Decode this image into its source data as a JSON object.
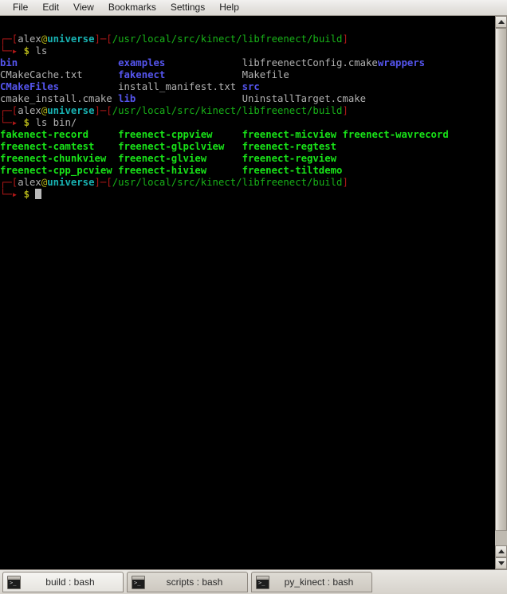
{
  "menubar": {
    "items": [
      {
        "label": "File"
      },
      {
        "label": "Edit"
      },
      {
        "label": "View"
      },
      {
        "label": "Bookmarks"
      },
      {
        "label": "Settings"
      },
      {
        "label": "Help"
      }
    ]
  },
  "terminal": {
    "colors": {
      "background": "#000000",
      "bracket_red": "#b21818",
      "user_gray": "#b2b2b2",
      "at_yellow": "#b2b218",
      "host_cyan": "#18b2b2",
      "path_green": "#18b218",
      "prompt_dollar_yellow": "#b2b218",
      "directory_blue": "#5555ee",
      "file_gray": "#b2b2b2",
      "executable_green": "#18e218",
      "cursor": "#b9b9b9"
    },
    "prompt": {
      "top_glyph": "┌─",
      "bottom_glyph": "└─▸",
      "open_bracket": "[",
      "close_bracket": "]",
      "separator": "─",
      "user": "alex",
      "at": "@",
      "host": "universe",
      "path": "/usr/local/src/kinect/libfreenect/build",
      "symbol": "$"
    },
    "blocks": [
      {
        "type": "prompt",
        "command": "ls"
      },
      {
        "type": "output",
        "rows": [
          [
            {
              "text": "bin",
              "kind": "dir"
            },
            {
              "text": "examples",
              "kind": "dir"
            },
            {
              "text": "libfreenectConfig.cmake",
              "kind": "file"
            },
            {
              "text": "wrappers",
              "kind": "dir"
            }
          ],
          [
            {
              "text": "CMakeCache.txt",
              "kind": "file"
            },
            {
              "text": "fakenect",
              "kind": "dir"
            },
            {
              "text": "Makefile",
              "kind": "file"
            },
            {
              "text": "",
              "kind": "file"
            }
          ],
          [
            {
              "text": "CMakeFiles",
              "kind": "dir"
            },
            {
              "text": "install_manifest.txt",
              "kind": "file"
            },
            {
              "text": "src",
              "kind": "dir"
            },
            {
              "text": "",
              "kind": "file"
            }
          ],
          [
            {
              "text": "cmake_install.cmake",
              "kind": "file"
            },
            {
              "text": "lib",
              "kind": "dir"
            },
            {
              "text": "UninstallTarget.cmake",
              "kind": "file"
            },
            {
              "text": "",
              "kind": "file"
            }
          ]
        ]
      },
      {
        "type": "prompt",
        "command": "ls bin/"
      },
      {
        "type": "output",
        "rows": [
          [
            {
              "text": "fakenect-record",
              "kind": "exec"
            },
            {
              "text": "freenect-cppview",
              "kind": "exec"
            },
            {
              "text": "freenect-micview",
              "kind": "exec"
            },
            {
              "text": "freenect-wavrecord",
              "kind": "exec"
            }
          ],
          [
            {
              "text": "freenect-camtest",
              "kind": "exec"
            },
            {
              "text": "freenect-glpclview",
              "kind": "exec"
            },
            {
              "text": "freenect-regtest",
              "kind": "exec"
            },
            {
              "text": "",
              "kind": "exec"
            }
          ],
          [
            {
              "text": "freenect-chunkview",
              "kind": "exec"
            },
            {
              "text": "freenect-glview",
              "kind": "exec"
            },
            {
              "text": "freenect-regview",
              "kind": "exec"
            },
            {
              "text": "",
              "kind": "exec"
            }
          ],
          [
            {
              "text": "freenect-cpp_pcview",
              "kind": "exec"
            },
            {
              "text": "freenect-hiview",
              "kind": "exec"
            },
            {
              "text": "freenect-tiltdemo",
              "kind": "exec"
            },
            {
              "text": "",
              "kind": "exec"
            }
          ]
        ]
      },
      {
        "type": "prompt",
        "command": ""
      }
    ]
  },
  "scrollbar": {
    "up_arrow": "▲",
    "down_arrow": "▼"
  },
  "tabs": [
    {
      "label": "build : bash",
      "active": true,
      "icon": "terminal-icon"
    },
    {
      "label": "scripts : bash",
      "active": false,
      "icon": "terminal-icon"
    },
    {
      "label": "py_kinect : bash",
      "active": false,
      "icon": "terminal-icon"
    }
  ]
}
